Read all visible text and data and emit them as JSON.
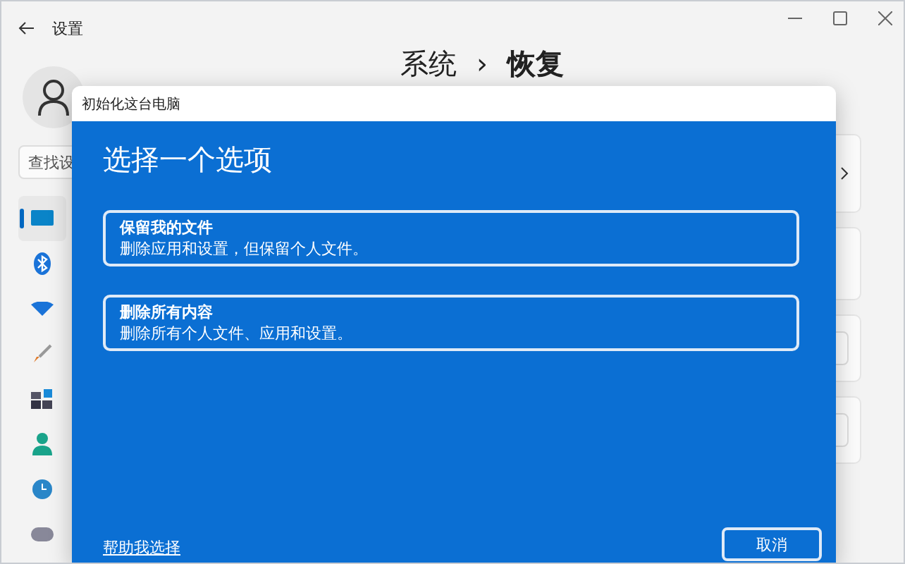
{
  "window": {
    "title": "设置"
  },
  "page": {
    "breadcrumb": "系统",
    "separator": "›",
    "heading": "恢复"
  },
  "search": {
    "placeholder": "查找设"
  },
  "sidebar": {
    "items": [
      {
        "selected": true
      },
      {
        "selected": false
      },
      {
        "selected": false
      },
      {
        "selected": false
      },
      {
        "selected": false
      },
      {
        "selected": false
      },
      {
        "selected": false
      },
      {
        "selected": false
      }
    ]
  },
  "dialog": {
    "title": "初始化这台电脑",
    "heading": "选择一个选项",
    "options": [
      {
        "title": "保留我的文件",
        "description": "删除应用和设置，但保留个人文件。"
      },
      {
        "title": "删除所有内容",
        "description": "删除所有个人文件、应用和设置。"
      }
    ],
    "help_link": "帮助我选择",
    "cancel": "取消"
  }
}
